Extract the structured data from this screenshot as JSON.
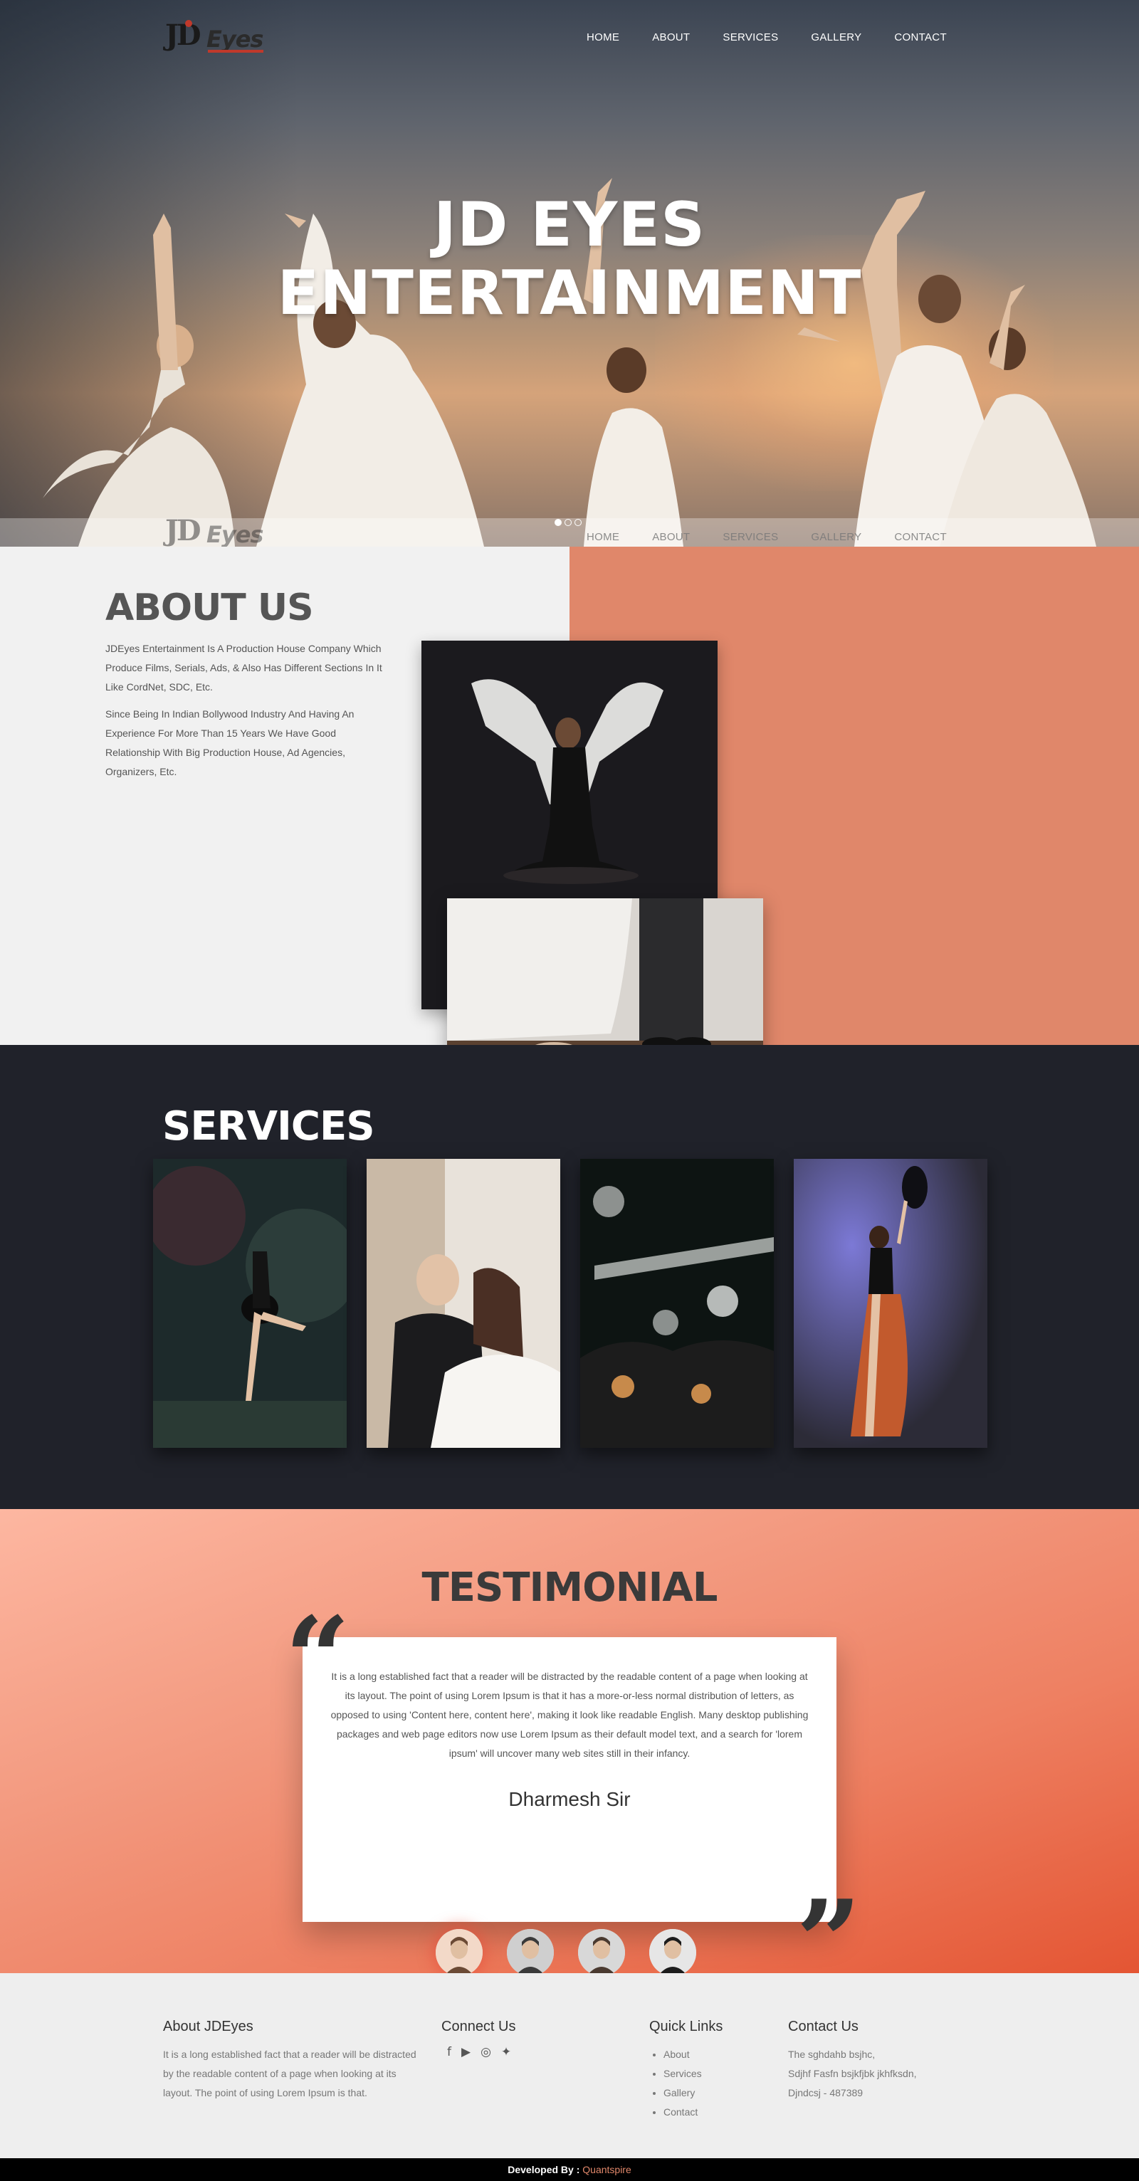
{
  "header": {
    "logo_text_jd": "JD",
    "logo_text_eyes": "Eyes",
    "nav": [
      "HOME",
      "ABOUT",
      "SERVICES",
      "GALLERY",
      "CONTACT"
    ]
  },
  "hero": {
    "title_line1": "JD EYES",
    "title_line2": "ENTERTAINMENT",
    "slides_total": 3,
    "slide_active": 1
  },
  "about": {
    "heading": "ABOUT US",
    "paragraph1": "JDEyes Entertainment Is A Production House Company Which Produce Films, Serials, Ads, & Also Has Different Sections In It Like CordNet, SDC, Etc.",
    "paragraph2": "Since Being In Indian Bollywood Industry And Having An Experience For More Than 15 Years We Have Good Relationship With Big Production House, Ad Agencies, Organizers, Etc."
  },
  "services": {
    "heading": "SERVICES"
  },
  "testimonial": {
    "heading": "TESTIMONIAL",
    "quote_open": "“",
    "quote_close": "”",
    "text": "It is a long established fact that a reader will be distracted by the readable content of a page when looking at its layout. The point of using Lorem Ipsum is that it has a more-or-less normal distribution of letters, as opposed to using 'Content here, content here', making it look like readable English. Many desktop publishing packages and web page editors now use Lorem Ipsum as their default model text, and a search for 'lorem ipsum' will uncover many web sites still in their infancy.",
    "name": "Dharmesh Sir",
    "avatar_count": 4,
    "active_avatar": 1
  },
  "footer": {
    "about": {
      "title": "About JDEyes",
      "text": "It is a long established fact that a reader will be distracted by the readable content of a page when looking at its layout. The point of using Lorem Ipsum is that."
    },
    "connect": {
      "title": "Connect Us",
      "icons": [
        "facebook-icon",
        "youtube-icon",
        "instagram-icon",
        "twitter-icon"
      ]
    },
    "links": {
      "title": "Quick Links",
      "items": [
        "About",
        "Services",
        "Gallery",
        "Contact"
      ]
    },
    "contact": {
      "title": "Contact Us",
      "line1": "The sghdahb bsjhc,",
      "line2": "Sdjhf Fasfn bsjkfjbk jkhfksdn,",
      "line3": "Djndcsj - 487389"
    },
    "developed_label": "Developed By :",
    "developer": "Quantspire"
  },
  "colors": {
    "accent": "#e0876a",
    "dark": "#20222a",
    "light": "#f1f1f1"
  }
}
